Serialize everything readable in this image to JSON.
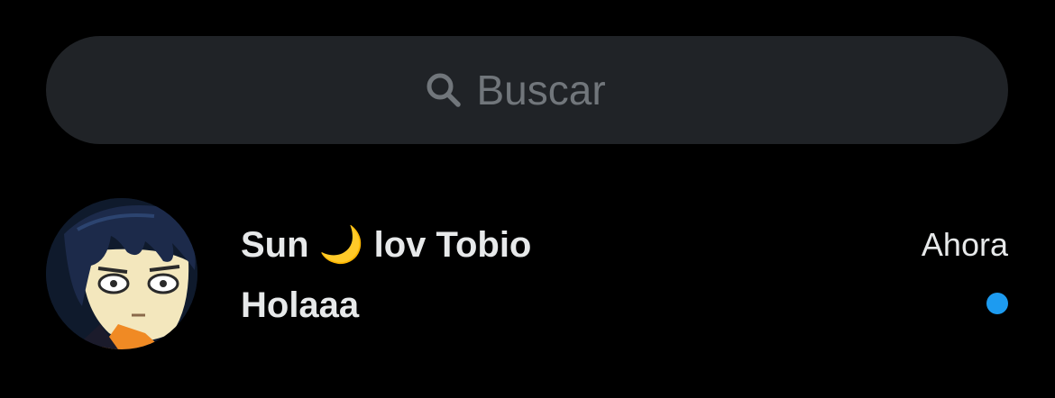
{
  "search": {
    "placeholder": "Buscar",
    "icon": "search-icon"
  },
  "conversation": {
    "name": "Sun 🌙 lov Tobio",
    "preview": "Holaaa",
    "time": "Ahora",
    "unread": true,
    "unread_color": "#1d9bf0",
    "avatar": "avatar-anime-character"
  },
  "colors": {
    "background": "#000000",
    "search_background": "#202327",
    "placeholder": "#71767b",
    "text": "#e7e9ea",
    "accent": "#1d9bf0"
  }
}
